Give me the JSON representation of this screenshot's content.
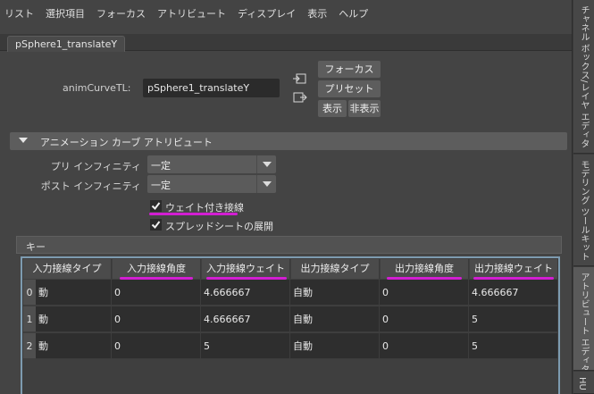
{
  "menu": [
    "リスト",
    "選択項目",
    "フォーカス",
    "アトリビュート",
    "ディスプレイ",
    "表示",
    "ヘルプ"
  ],
  "tab": "pSphere1_translateY",
  "curve": {
    "label": "animCurveTL:",
    "value": "pSphere1_translateY"
  },
  "buttons": {
    "focus": "フォーカス",
    "preset": "プリセット",
    "show": "表示",
    "hide": "非表示"
  },
  "section": {
    "title": "アニメーション カーブ アトリビュート"
  },
  "pre_infinity": {
    "label": "プリ インフィニティ",
    "value": "一定"
  },
  "post_infinity": {
    "label": "ポスト インフィニティ",
    "value": "一定"
  },
  "weighted": {
    "label": "ウェイト付き接線",
    "checked": true
  },
  "spreadsheet": {
    "label": "スプレッドシートの展開",
    "checked": true
  },
  "keys": {
    "title": "キー",
    "columns": [
      "入力接線タイプ",
      "入力接線角度",
      "入力接線ウェイト",
      "出力接線タイプ",
      "出力接線角度",
      "出力接線ウェイト"
    ],
    "rows": [
      {
        "index": "0",
        "cells": [
          "動",
          "0",
          "4.666667",
          "自動",
          "0",
          "4.666667"
        ]
      },
      {
        "index": "1",
        "cells": [
          "動",
          "0",
          "4.666667",
          "自動",
          "0",
          "5"
        ]
      },
      {
        "index": "2",
        "cells": [
          "動",
          "0",
          "5",
          "自動",
          "0",
          "5"
        ]
      }
    ]
  },
  "side_tabs": [
    "チャネル ボックス/レイヤ エディタ",
    "モデリング ツールキット",
    "アトリビュート エディタ",
    "HU"
  ],
  "colors": {
    "highlight_underline": "#d21ed2",
    "table_border": "#7d9bb0"
  }
}
